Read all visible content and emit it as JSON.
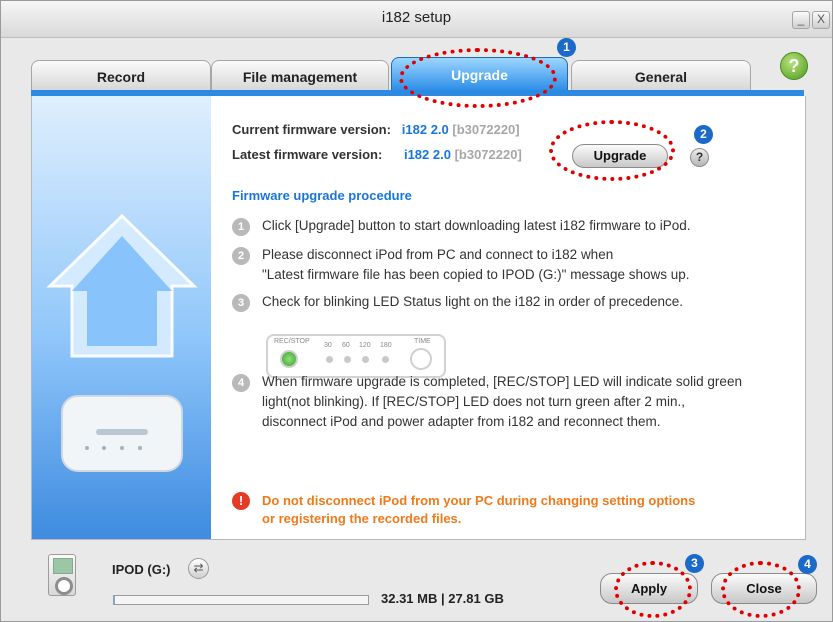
{
  "window": {
    "title": "i182 setup",
    "minimize": "_",
    "close": "X"
  },
  "help": {
    "label": "?"
  },
  "tabs": [
    {
      "label": "Record"
    },
    {
      "label": "File management"
    },
    {
      "label": "Upgrade"
    },
    {
      "label": "General"
    }
  ],
  "firmware": {
    "current_label": "Current firmware version:",
    "current_version": "i182 2.0",
    "current_build": "[b3072220]",
    "latest_label": "Latest firmware version:",
    "latest_version": "i182 2.0",
    "latest_build": "[b3072220]",
    "upgrade_button": "Upgrade",
    "help": "?"
  },
  "procedure": {
    "title": "Firmware upgrade procedure",
    "steps": [
      {
        "num": "1",
        "text": "Click [Upgrade] button to start downloading latest i182 firmware to iPod."
      },
      {
        "num": "2",
        "text": "Please disconnect iPod from PC and connect to i182 when\n\"Latest firmware file has been copied to IPOD (G:)\" message shows up."
      },
      {
        "num": "3",
        "text": "Check for blinking LED Status light on the i182 in order of precedence."
      },
      {
        "num": "4",
        "text": "When firmware upgrade is completed, [REC/STOP] LED will indicate solid green\nlight(not blinking). If [REC/STOP] LED does not turn green after 2 min.,\ndisconnect iPod and power adapter from i182 and reconnect them."
      }
    ],
    "led_labels": {
      "rec": "REC/STOP",
      "t30": "30",
      "t60": "60",
      "t120": "120",
      "t180": "180",
      "time": "TIME"
    }
  },
  "warning": {
    "icon": "!",
    "text": "Do not disconnect iPod from your PC during changing setting options\nor registering the recorded files."
  },
  "device": {
    "name": "IPOD (G:)",
    "storage": "32.31 MB | 27.81 GB",
    "used_fraction": 0.001
  },
  "buttons": {
    "apply": "Apply",
    "close": "Close"
  },
  "badges": [
    "1",
    "2",
    "3",
    "4"
  ],
  "colors": {
    "accent": "#2b8ce7",
    "link_blue": "#1876d9",
    "warning": "#f07a1a",
    "marker_red": "#e10000",
    "badge_blue": "#1b69c9"
  }
}
